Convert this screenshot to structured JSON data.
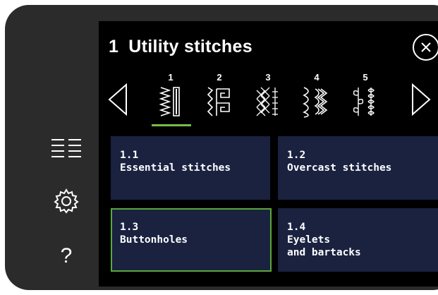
{
  "screen": {
    "number": "1",
    "title": "Utility stitches"
  },
  "tabs": [
    {
      "label": "1",
      "selected": true,
      "icon": "zigzag-stitch-icon"
    },
    {
      "label": "2",
      "selected": false,
      "icon": "square-stitch-icon"
    },
    {
      "label": "3",
      "selected": false,
      "icon": "cross-stitch-icon"
    },
    {
      "label": "4",
      "selected": false,
      "icon": "scallop-stitch-icon"
    },
    {
      "label": "5",
      "selected": false,
      "icon": "leaf-stitch-icon"
    }
  ],
  "categories": [
    {
      "number": "1.1",
      "title": "Essential stitches",
      "selected": false
    },
    {
      "number": "1.2",
      "title": "Overcast stitches",
      "selected": false
    },
    {
      "number": "1.3",
      "title": "Buttonholes",
      "selected": true
    },
    {
      "number": "1.4",
      "title": "Eyelets\nand bartacks",
      "selected": false
    }
  ],
  "left_rail": {
    "icons": [
      "menu-list-icon",
      "settings-gear-icon",
      "help-icon"
    ],
    "help_label": "?"
  },
  "colors": {
    "bezel": "#2b2b2b",
    "screen": "#000000",
    "tile": "#1a2240",
    "accent": "#79bb4c"
  }
}
